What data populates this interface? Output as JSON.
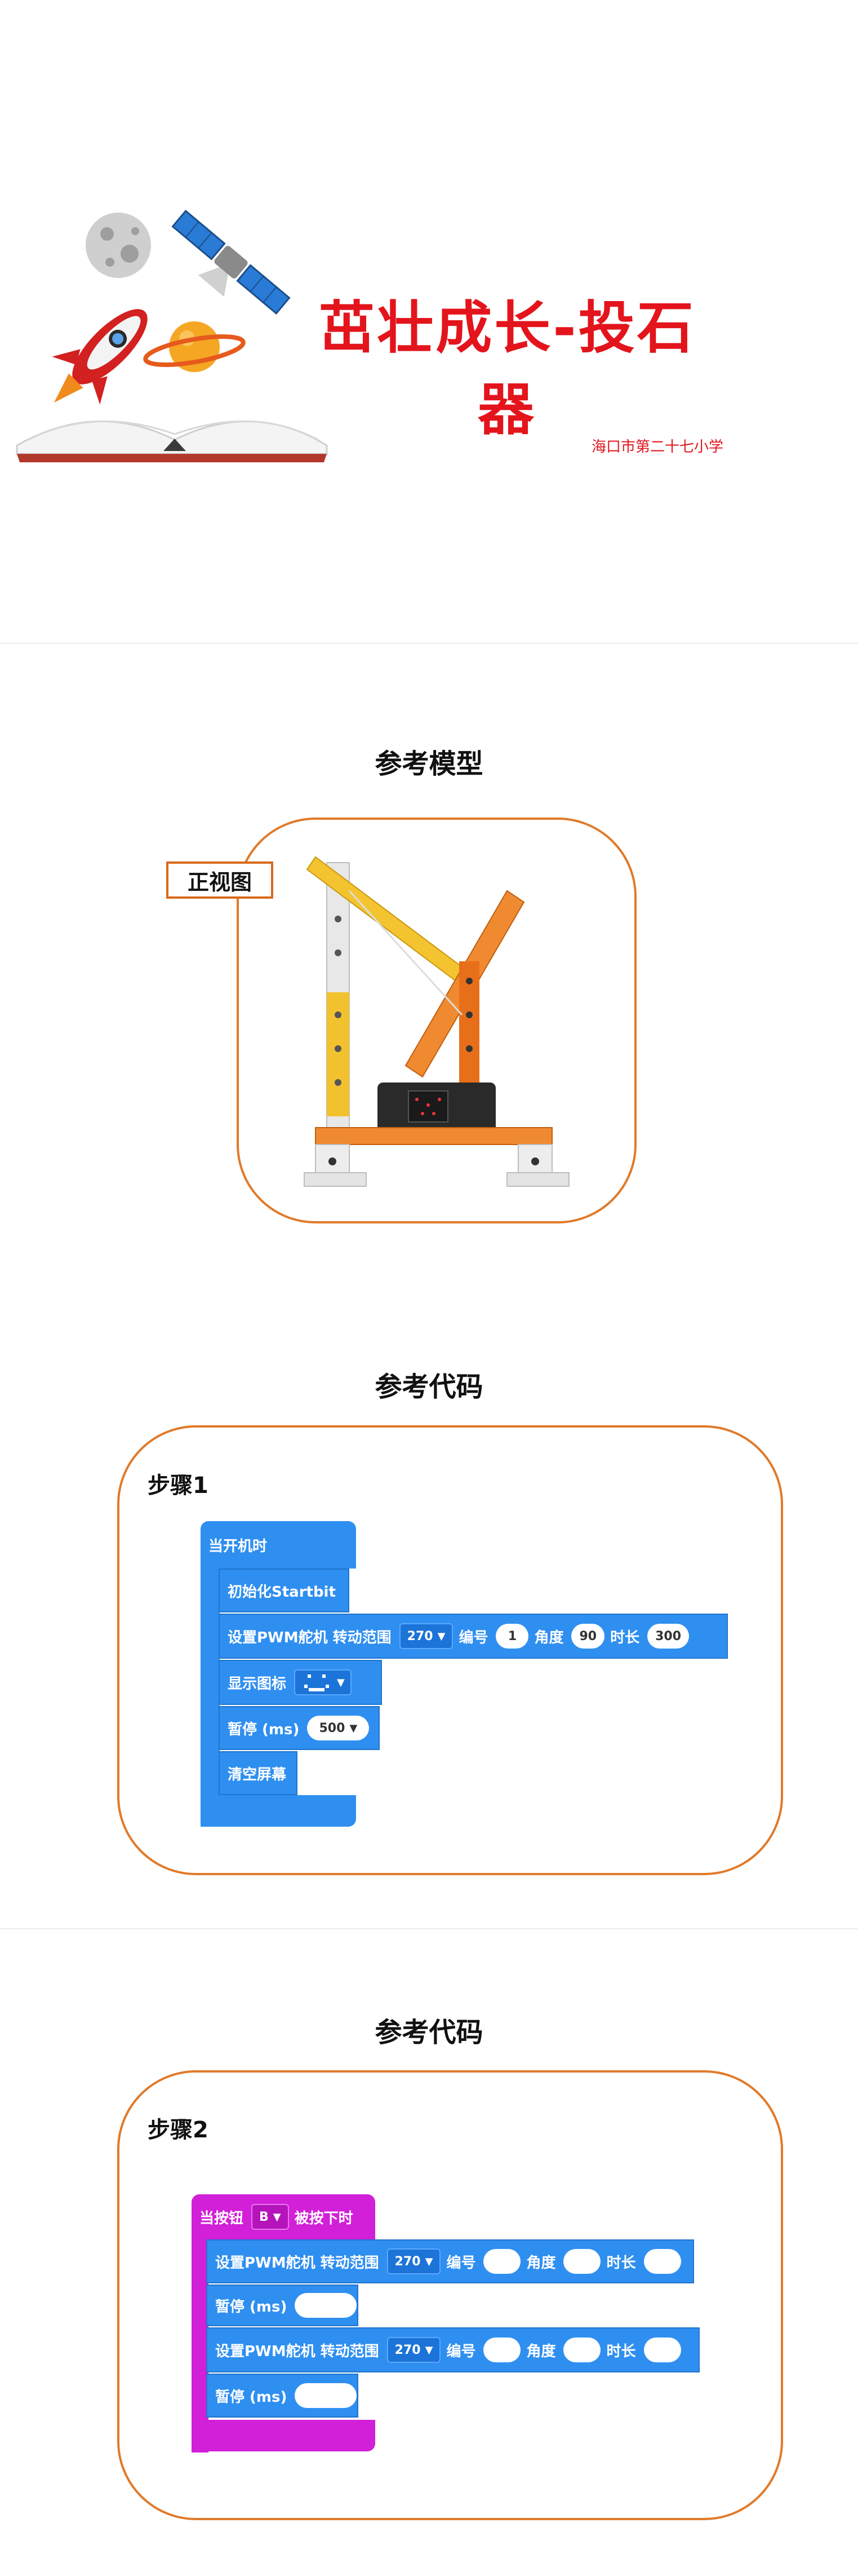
{
  "cover": {
    "title": "茁壮成长-投石器",
    "school": "海口市第二十七小学"
  },
  "model_section": {
    "title": "参考模型",
    "front_view_label": "正视图"
  },
  "code_section_1": {
    "title": "参考代码",
    "step": "步骤1",
    "blocks": {
      "hat": "当开机时",
      "init": "初始化Startbit",
      "servo_label": "设置PWM舵机 转动范围",
      "servo_range": "270",
      "servo_num_label": "编号",
      "servo_num": "1",
      "servo_angle_label": "角度",
      "servo_angle": "90",
      "servo_duration_label": "时长",
      "servo_duration": "300",
      "show_icon": "显示图标",
      "pause_label": "暂停 (ms)",
      "pause_value": "500",
      "clear": "清空屏幕"
    }
  },
  "code_section_2": {
    "title": "参考代码",
    "step": "步骤2",
    "blocks": {
      "hat_label": "当按钮",
      "hat_button": "B",
      "hat_suffix": "被按下时",
      "servo_label": "设置PWM舵机 转动范围",
      "servo_range": "270",
      "servo_num_label": "编号",
      "servo_angle_label": "角度",
      "servo_duration_label": "时长",
      "pause_label": "暂停 (ms)"
    }
  },
  "colors": {
    "title_red": "#e3141c",
    "frame_orange": "#e07a2a",
    "block_blue": "#2f8ff0",
    "block_magenta": "#d21fd8"
  }
}
